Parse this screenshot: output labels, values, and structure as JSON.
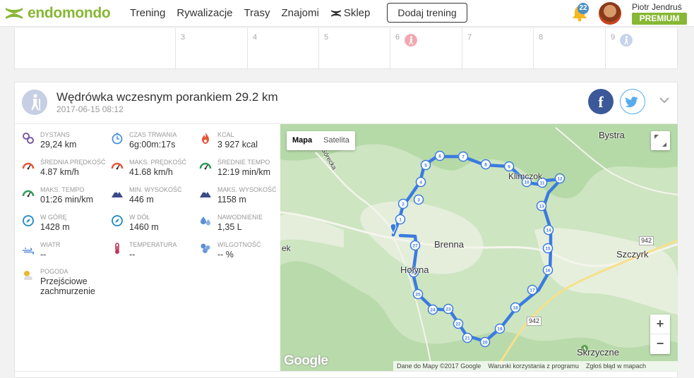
{
  "brand": {
    "name": "endomondo"
  },
  "nav": {
    "items": [
      "Trening",
      "Rywalizacje",
      "Trasy",
      "Znajomi"
    ],
    "shop": "Sklep"
  },
  "header": {
    "add_button": "Dodaj trening",
    "notifications_count": "22",
    "user_name": "Piotr Jendruś",
    "badge": "PREMIUM"
  },
  "calendar": {
    "days": [
      "3",
      "4",
      "5",
      "6",
      "7",
      "8",
      "9"
    ]
  },
  "workout": {
    "title": "Wędrówka wczesnym porankiem 29.2 km",
    "datetime": "2017-06-15 08:12",
    "stats": [
      {
        "label": "Dystans",
        "value": "29,24 km",
        "icon": "distance-icon",
        "color": "#7a5ba6"
      },
      {
        "label": "Czas trwania",
        "value": "6g:00m:17s",
        "icon": "stopwatch-icon",
        "color": "#4a90e2"
      },
      {
        "label": "Kcal",
        "value": "3 927 kcal",
        "icon": "flame-icon",
        "color": "#e8553a"
      },
      {
        "label": "Średnia prędkość",
        "value": "4.87 km/h",
        "icon": "speedometer-icon",
        "color": "#e8553a"
      },
      {
        "label": "Maks. prędkość",
        "value": "41.68 km/h",
        "icon": "speedometer-icon",
        "color": "#e8553a"
      },
      {
        "label": "Średnie tempo",
        "value": "12:19 min/km",
        "icon": "speedometer-icon",
        "color": "#2e9c5c"
      },
      {
        "label": "Maks. tempo",
        "value": "01:26 min/km",
        "icon": "speedometer-icon",
        "color": "#2e9c5c"
      },
      {
        "label": "Min. wysokość",
        "value": "446 m",
        "icon": "mountain-icon",
        "color": "#3a4a8a"
      },
      {
        "label": "Maks. wysokość",
        "value": "1158 m",
        "icon": "mountain-icon",
        "color": "#3a4a8a"
      },
      {
        "label": "W górę",
        "value": "1428 m",
        "icon": "compass-icon",
        "color": "#1e88c8"
      },
      {
        "label": "W dół",
        "value": "1460 m",
        "icon": "compass-icon",
        "color": "#1e88c8"
      },
      {
        "label": "Nawodnienie",
        "value": "1,35 L",
        "icon": "water-drops-icon",
        "color": "#5b8fd6"
      },
      {
        "label": "Wiatr",
        "value": "--",
        "icon": "wind-icon",
        "color": "#5b8fd6"
      },
      {
        "label": "Temperatura",
        "value": "--",
        "icon": "thermometer-icon",
        "color": "#c0365a"
      },
      {
        "label": "Wilgotność",
        "value": "-- %",
        "icon": "humidity-icon",
        "color": "#5b8fd6"
      },
      {
        "label": "Pogoda",
        "value": "Przejściowe zachmurzenie",
        "icon": "cloud-sun-icon",
        "color": "#f0b429"
      }
    ]
  },
  "map": {
    "toggle": [
      "Mapa",
      "Satelita"
    ],
    "places": [
      "Bystra",
      "Klimczok",
      "Brenna",
      "Szczyrk",
      "Hołyna",
      "Skrzyczne",
      "Górecka",
      "ek"
    ],
    "road_number": "942",
    "markers": [
      "1",
      "2",
      "3",
      "4",
      "5",
      "6",
      "7",
      "8",
      "9",
      "10",
      "11",
      "12",
      "13",
      "14",
      "15",
      "16",
      "17",
      "18",
      "19",
      "20",
      "21",
      "22",
      "23",
      "24",
      "25",
      "26",
      "27",
      "28"
    ],
    "provider": "Google",
    "attribution": [
      "Dane do Mapy ©2017 Google",
      "Warunki korzystania z programu",
      "Zgłoś błąd w mapach"
    ],
    "route_color": "#3b7be0"
  }
}
